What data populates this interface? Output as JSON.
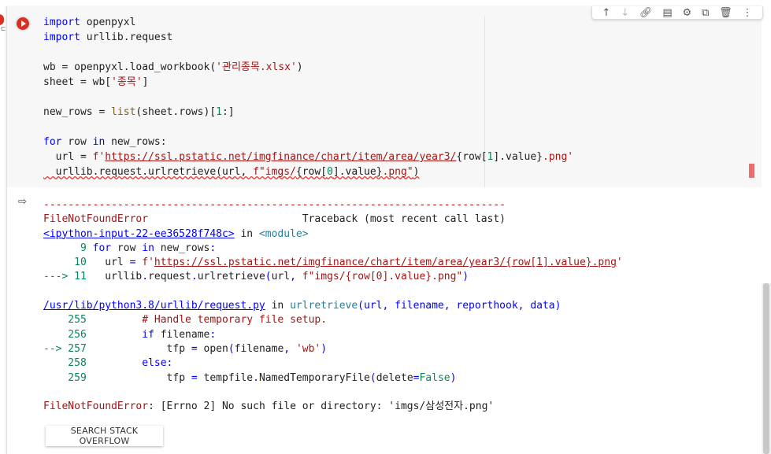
{
  "toolbar": {
    "icons": [
      "arrow-up-icon",
      "arrow-down-icon",
      "link-icon",
      "comment-icon",
      "settings-icon",
      "mirror-icon",
      "delete-icon",
      "more-icon"
    ]
  },
  "code_lines": [
    [
      {
        "t": "kw",
        "v": "import"
      },
      {
        "t": "",
        "v": " openpyxl"
      }
    ],
    [
      {
        "t": "kw",
        "v": "import"
      },
      {
        "t": "",
        "v": " urllib.request"
      }
    ],
    [],
    [
      {
        "t": "",
        "v": "wb = openpyxl.load_workbook("
      },
      {
        "t": "str",
        "v": "'관리종목.xlsx'"
      },
      {
        "t": "",
        "v": ")"
      }
    ],
    [
      {
        "t": "",
        "v": "sheet = wb["
      },
      {
        "t": "str",
        "v": "'종목'"
      },
      {
        "t": "",
        "v": "]"
      }
    ],
    [],
    [
      {
        "t": "",
        "v": "new_rows = "
      },
      {
        "t": "fn",
        "v": "list"
      },
      {
        "t": "",
        "v": "(sheet.rows)["
      },
      {
        "t": "num",
        "v": "1"
      },
      {
        "t": "",
        "v": ":]"
      }
    ],
    [],
    [
      {
        "t": "kw",
        "v": "for"
      },
      {
        "t": "",
        "v": " row "
      },
      {
        "t": "kw",
        "v": "in"
      },
      {
        "t": "",
        "v": " new_rows:"
      }
    ],
    [
      {
        "t": "",
        "v": "  url = "
      },
      {
        "t": "str",
        "v": "f'"
      },
      {
        "t": "url",
        "v": "https://ssl.pstatic.net/imgfinance/chart/item/area/year3/"
      },
      {
        "t": "",
        "v": "{row["
      },
      {
        "t": "num",
        "v": "1"
      },
      {
        "t": "",
        "v": "].value}"
      },
      {
        "t": "str",
        "v": ".png'"
      }
    ],
    [
      {
        "t": "squig",
        "v": "  urllib.request.urlretrieve(url, "
      },
      {
        "t": "squig str",
        "v": "f\"imgs/"
      },
      {
        "t": "squig",
        "v": "{row["
      },
      {
        "t": "squig num",
        "v": "0"
      },
      {
        "t": "squig",
        "v": "].value}"
      },
      {
        "t": "squig str",
        "v": ".png\""
      },
      {
        "t": "squig",
        "v": ")"
      }
    ]
  ],
  "output_lines": [
    [
      {
        "t": "o-red",
        "v": "---------------------------------------------------------------------------"
      }
    ],
    [
      {
        "t": "o-red",
        "v": "FileNotFoundError"
      },
      {
        "t": "",
        "v": "                         Traceback (most recent call last)"
      }
    ],
    [
      {
        "t": "o-link",
        "v": "<ipython-input-22-ee36528f748c>"
      },
      {
        "t": "",
        "v": " in "
      },
      {
        "t": "o-cyan",
        "v": "<module>"
      }
    ],
    [
      {
        "t": "o-green",
        "v": "      9"
      },
      {
        "t": "",
        "v": " "
      },
      {
        "t": "o-blue",
        "v": "for"
      },
      {
        "t": "",
        "v": " row "
      },
      {
        "t": "o-blue",
        "v": "in"
      },
      {
        "t": "",
        "v": " new_rows"
      },
      {
        "t": "o-blue",
        "v": ":"
      }
    ],
    [
      {
        "t": "o-green",
        "v": "     10"
      },
      {
        "t": "",
        "v": "   url "
      },
      {
        "t": "o-blue",
        "v": "="
      },
      {
        "t": "",
        "v": " "
      },
      {
        "t": "o-red",
        "v": "f'"
      },
      {
        "t": "o-link-red",
        "v": "https://ssl.pstatic.net/imgfinance/chart/item/area/year3/{row[1].value}.png"
      },
      {
        "t": "o-red",
        "v": "'"
      }
    ],
    [
      {
        "t": "o-green",
        "v": "---> 11"
      },
      {
        "t": "",
        "v": "   urllib"
      },
      {
        "t": "o-blue",
        "v": "."
      },
      {
        "t": "",
        "v": "request"
      },
      {
        "t": "o-blue",
        "v": "."
      },
      {
        "t": "",
        "v": "urlretrieve"
      },
      {
        "t": "o-blue",
        "v": "("
      },
      {
        "t": "",
        "v": "url"
      },
      {
        "t": "o-blue",
        "v": ","
      },
      {
        "t": "",
        "v": " "
      },
      {
        "t": "o-red",
        "v": "f\"imgs/{row[0].value}.png\""
      },
      {
        "t": "o-blue",
        "v": ")"
      }
    ],
    [],
    [
      {
        "t": "o-link",
        "v": "/usr/lib/python3.8/urllib/request.py"
      },
      {
        "t": "",
        "v": " in "
      },
      {
        "t": "o-cyan",
        "v": "urlretrieve"
      },
      {
        "t": "o-blue",
        "v": "(url, filename, reporthook, data)"
      }
    ],
    [
      {
        "t": "o-green",
        "v": "    255"
      },
      {
        "t": "",
        "v": "         "
      },
      {
        "t": "o-red",
        "v": "# Handle temporary file setup."
      }
    ],
    [
      {
        "t": "o-green",
        "v": "    256"
      },
      {
        "t": "",
        "v": "         "
      },
      {
        "t": "o-blue",
        "v": "if"
      },
      {
        "t": "",
        "v": " filename"
      },
      {
        "t": "o-blue",
        "v": ":"
      }
    ],
    [
      {
        "t": "o-green",
        "v": "--> 257"
      },
      {
        "t": "",
        "v": "             tfp "
      },
      {
        "t": "o-blue",
        "v": "="
      },
      {
        "t": "",
        "v": " open"
      },
      {
        "t": "o-blue",
        "v": "("
      },
      {
        "t": "",
        "v": "filename"
      },
      {
        "t": "o-blue",
        "v": ","
      },
      {
        "t": "",
        "v": " "
      },
      {
        "t": "o-red",
        "v": "'wb'"
      },
      {
        "t": "o-blue",
        "v": ")"
      }
    ],
    [
      {
        "t": "o-green",
        "v": "    258"
      },
      {
        "t": "",
        "v": "         "
      },
      {
        "t": "o-blue",
        "v": "else:"
      }
    ],
    [
      {
        "t": "o-green",
        "v": "    259"
      },
      {
        "t": "",
        "v": "             tfp "
      },
      {
        "t": "o-blue",
        "v": "="
      },
      {
        "t": "",
        "v": " tempfile"
      },
      {
        "t": "o-blue",
        "v": "."
      },
      {
        "t": "",
        "v": "NamedTemporaryFile"
      },
      {
        "t": "o-blue",
        "v": "("
      },
      {
        "t": "",
        "v": "delete"
      },
      {
        "t": "o-blue",
        "v": "="
      },
      {
        "t": "o-green",
        "v": "False"
      },
      {
        "t": "o-blue",
        "v": ")"
      }
    ],
    [],
    [
      {
        "t": "o-red",
        "v": "FileNotFoundError"
      },
      {
        "t": "",
        "v": ": [Errno 2] No such file or directory: 'imgs/삼성전자.png'"
      }
    ]
  ],
  "search_button_label": "SEARCH STACK OVERFLOW"
}
